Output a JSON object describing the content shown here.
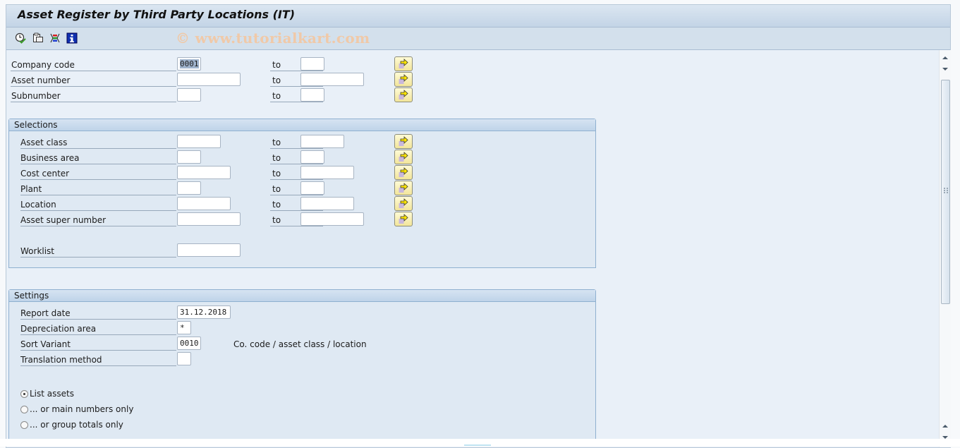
{
  "window": {
    "title": "Asset Register by Third Party Locations (IT)",
    "watermark": "© www.tutorialkart.com"
  },
  "toolbar": {
    "icons": [
      {
        "name": "execute-icon",
        "tooltip": "Execute"
      },
      {
        "name": "get-variant-icon",
        "tooltip": "Get Variant"
      },
      {
        "name": "dynamic-selections-icon",
        "tooltip": "Dynamic Selections"
      },
      {
        "name": "information-icon",
        "tooltip": "Information"
      }
    ]
  },
  "to_label": "to",
  "top_fields": [
    {
      "label": "Company code",
      "from": "0001",
      "to": ""
    },
    {
      "label": "Asset number",
      "from": "",
      "to": ""
    },
    {
      "label": "Subnumber",
      "from": "",
      "to": ""
    }
  ],
  "selections": {
    "title": "Selections",
    "fields": [
      {
        "label": "Asset class",
        "from": "",
        "to": ""
      },
      {
        "label": "Business area",
        "from": "",
        "to": ""
      },
      {
        "label": "Cost center",
        "from": "",
        "to": ""
      },
      {
        "label": "Plant",
        "from": "",
        "to": ""
      },
      {
        "label": "Location",
        "from": "",
        "to": ""
      },
      {
        "label": "Asset super number",
        "from": "",
        "to": ""
      }
    ],
    "worklist": {
      "label": "Worklist",
      "value": ""
    }
  },
  "settings": {
    "title": "Settings",
    "fields": [
      {
        "label": "Report date",
        "value": "31.12.2018"
      },
      {
        "label": "Depreciation area",
        "value": "*"
      },
      {
        "label": "Sort Variant",
        "value": "0010",
        "description": "Co. code / asset class / location"
      },
      {
        "label": "Translation method",
        "value": ""
      }
    ],
    "radios": [
      {
        "label": "List assets",
        "selected": true
      },
      {
        "label": "... or main numbers only",
        "selected": false
      },
      {
        "label": "... or group totals only",
        "selected": false
      }
    ]
  }
}
